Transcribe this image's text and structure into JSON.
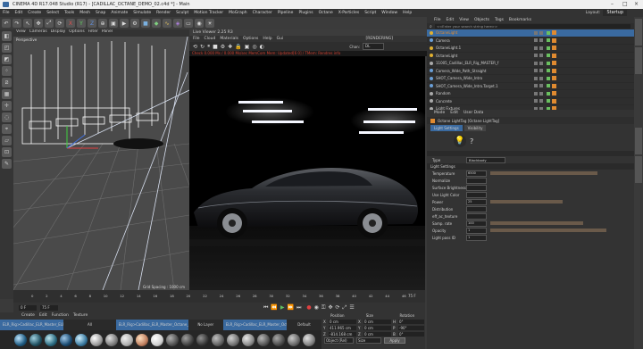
{
  "window": {
    "title": "CINEMA 4D R17.048 Studio (R17) - [CADILLAC_OCTANE_DEMO_02.c4d *] - Main",
    "layout_label": "Layout:",
    "layout_value": "Startup"
  },
  "menubar": [
    "File",
    "Edit",
    "Create",
    "Select",
    "Tools",
    "Mesh",
    "Snap",
    "Animate",
    "Simulate",
    "Render",
    "Sculpt",
    "Motion Tracker",
    "MoGraph",
    "Character",
    "Pipeline",
    "Plugins",
    "Octane",
    "X-Particles",
    "Script",
    "Window",
    "Help"
  ],
  "viewport": {
    "menu": [
      "View",
      "Cameras",
      "Display",
      "Options",
      "Filter",
      "Panel"
    ],
    "label": "Perspective",
    "grid_label": "Grid Spacing : 1000 cm"
  },
  "live_viewer": {
    "title": "Live Viewer 2.25 R3",
    "menu": [
      "File",
      "Cloud",
      "Materials",
      "Options",
      "Help",
      "Gui"
    ],
    "rendering_label": "[RENDERING]",
    "channel_label": "Chan:",
    "channel_value": "DL",
    "status_text": "Check 0.000 Ms / 0.000 Ms/sec  MemCom Mem: Updated[6 0] / TMem: Rendres info"
  },
  "timeline": {
    "ticks": [
      "0",
      "2",
      "4",
      "6",
      "8",
      "10",
      "12",
      "14",
      "16",
      "18",
      "20",
      "22",
      "24",
      "26",
      "28",
      "30",
      "32",
      "34",
      "36",
      "38",
      "40",
      "42",
      "44",
      "46"
    ],
    "frame_end": "75 F",
    "start_field": "0 F",
    "end_field": "75 F"
  },
  "material_manager": {
    "menu": [
      "Create",
      "Edit",
      "Function",
      "Texture"
    ],
    "header": [
      "All",
      "No Layer",
      "Default"
    ],
    "chips": [
      "ELR_Rig>Cadillac_ELR_Master_ELR_Rig>Gum",
      "ELR_Rig>Cadillac_ELR_Master_Octane_003>ELR_Rig>Stra",
      "ELR_Rig>Cadillac_ELR_Master_Octane_003>ELR_Rig>Tires"
    ]
  },
  "coordinates": {
    "headers": [
      "Position",
      "Size",
      "Rotation"
    ],
    "rows": [
      {
        "axis": "X",
        "pos": "0 cm",
        "size": "0 cm",
        "rot_axis": "H",
        "rot": "0°"
      },
      {
        "axis": "Y",
        "pos": "411.965 cm",
        "size": "0 cm",
        "rot_axis": "P",
        "rot": "-90°"
      },
      {
        "axis": "Z",
        "pos": "-814.168 cm",
        "size": "0 cm",
        "rot_axis": "B",
        "rot": "0°"
      }
    ],
    "mode": "Object (Rel)",
    "size_mode": "Size",
    "apply": "Apply"
  },
  "object_manager": {
    "menu": [
      "File",
      "Edit",
      "View",
      "Objects",
      "Tags",
      "Bookmarks"
    ],
    "search_placeholder": "<<Enter your search string here>>",
    "objects": [
      {
        "name": "OctaneLight",
        "selected": true,
        "dot": "#e0b030"
      },
      {
        "name": "Camera",
        "selected": false,
        "dot": "#6a9fd8"
      },
      {
        "name": "OctaneLight.1",
        "selected": false,
        "dot": "#e0b030"
      },
      {
        "name": "OctaneLight",
        "selected": false,
        "dot": "#e0b030"
      },
      {
        "name": "11005_Cadillac_ELR_Rig_MASTER_f",
        "selected": false,
        "dot": "#aaaaaa"
      },
      {
        "name": "Camera_Wide_Path_Straight",
        "selected": false,
        "dot": "#6a9fd8"
      },
      {
        "name": "SHOT_Camera_Wide_Intro",
        "selected": false,
        "dot": "#6a9fd8"
      },
      {
        "name": "SHOT_Camera_Wide_Intro.Target.1",
        "selected": false,
        "dot": "#6a9fd8"
      },
      {
        "name": "Random",
        "selected": false,
        "dot": "#aaaaaa"
      },
      {
        "name": "Concrete",
        "selected": false,
        "dot": "#aaaaaa"
      },
      {
        "name": "Light Fixtures",
        "selected": false,
        "dot": "#aaaaaa"
      }
    ]
  },
  "attribute_manager": {
    "menu": [
      "Mode",
      "Edit",
      "User Data"
    ],
    "tag_title": "Octane LightTag [Octane LightTag]",
    "tabs": [
      "Light Settings",
      "Visibility"
    ],
    "type_label": "Type",
    "type_value": "Blackbody",
    "section": "Light Settings",
    "params": [
      {
        "label": "Temperature",
        "value": "6500",
        "fill": 0.92
      },
      {
        "label": "Normalize",
        "value": "",
        "fill": 0
      },
      {
        "label": "Surface Brightness",
        "value": "",
        "fill": 0
      },
      {
        "label": "Use Light Color",
        "value": "",
        "fill": 0
      },
      {
        "label": "Power",
        "value": "25",
        "fill": 0.62
      },
      {
        "label": "Distribution",
        "value": "",
        "fill": 0
      },
      {
        "label": "eff_ac_texture",
        "value": "",
        "fill": 0
      },
      {
        "label": "Samp. rate",
        "value": "100",
        "fill": 0.8
      },
      {
        "label": "Opacity",
        "value": "1",
        "fill": 1.0
      },
      {
        "label": "Light pass ID",
        "value": "1",
        "fill": 0.0
      }
    ]
  },
  "colors": {
    "accent_orange": "#e08a30",
    "selection_blue": "#3a6aa0",
    "status_red": "#d04030"
  }
}
